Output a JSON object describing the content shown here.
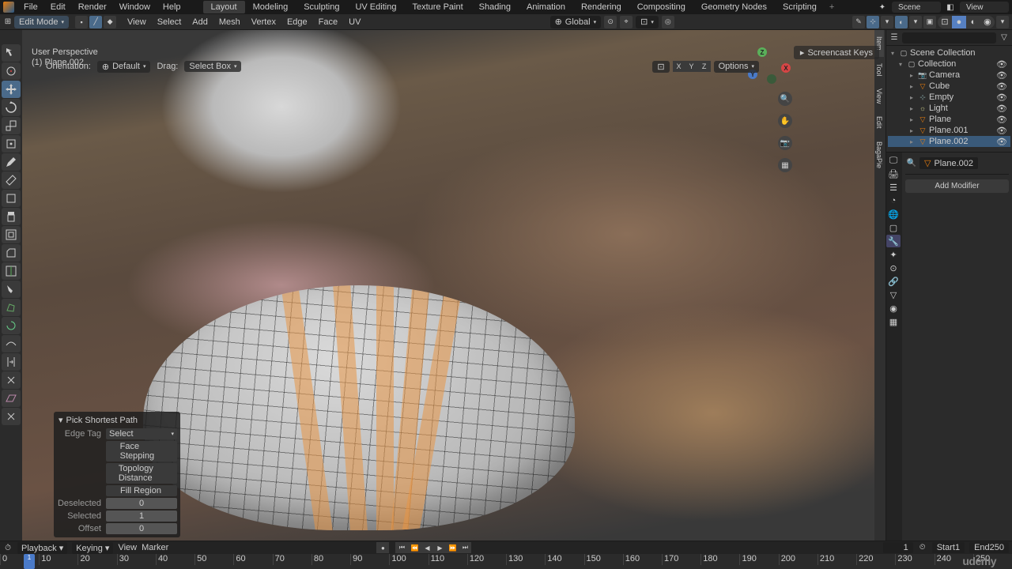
{
  "menu": {
    "file": "File",
    "edit": "Edit",
    "render": "Render",
    "window": "Window",
    "help": "Help"
  },
  "workspaces": {
    "layout": "Layout",
    "modeling": "Modeling",
    "sculpting": "Sculpting",
    "uv": "UV Editing",
    "texpaint": "Texture Paint",
    "shading": "Shading",
    "anim": "Animation",
    "render": "Rendering",
    "comp": "Compositing",
    "geo": "Geometry Nodes",
    "script": "Scripting"
  },
  "scene": {
    "scene_label": "Scene",
    "layer_label": "View"
  },
  "toolbar2": {
    "mode": "Edit Mode",
    "menus": {
      "view": "View",
      "select": "Select",
      "add": "Add",
      "mesh": "Mesh",
      "vertex": "Vertex",
      "edge": "Edge",
      "face": "Face",
      "uv": "UV"
    },
    "global": "Global"
  },
  "toolbar3": {
    "orient_label": "Orientation:",
    "orient_mode": "Default",
    "drag_label": "Drag:",
    "drag_mode": "Select Box",
    "options": "Options"
  },
  "overlay": {
    "persp": "User Perspective",
    "obj": "(1) Plane.002"
  },
  "rtabs": {
    "item": "Item",
    "tool": "Tool",
    "view": "View",
    "edit": "Edit",
    "bagapie": "BagaPie"
  },
  "scpanel": {
    "label": "Screencast Keys"
  },
  "gizmo": {
    "x": "X",
    "y": "Y",
    "z": "Z"
  },
  "outliner": {
    "search_placeholder": "",
    "collection": "Scene Collection",
    "coll2": "Collection",
    "items": [
      {
        "name": "Camera",
        "cls": "cam"
      },
      {
        "name": "Cube",
        "cls": "mesh"
      },
      {
        "name": "Empty",
        "cls": "empty"
      },
      {
        "name": "Light",
        "cls": "light"
      },
      {
        "name": "Plane",
        "cls": "mesh"
      },
      {
        "name": "Plane.001",
        "cls": "mesh"
      },
      {
        "name": "Plane.002",
        "cls": "mesh"
      }
    ]
  },
  "props": {
    "object": "Plane.002",
    "addmod": "Add Modifier"
  },
  "oppanel": {
    "title": "Pick Shortest Path",
    "edge_tag_label": "Edge Tag",
    "edge_tag_val": "Select",
    "face_step": "Face Stepping",
    "topo_dist": "Topology Distance",
    "fill_region": "Fill Region",
    "deselected_label": "Deselected",
    "deselected_val": "0",
    "selected_label": "Selected",
    "selected_val": "1",
    "offset_label": "Offset",
    "offset_val": "0"
  },
  "timeline": {
    "playback": "Playback",
    "keying": "Keying",
    "view": "View",
    "marker": "Marker",
    "current": "1",
    "start_label": "Start",
    "start": "1",
    "end_label": "End",
    "end": "250",
    "ticks": [
      "0",
      "10",
      "20",
      "30",
      "40",
      "50",
      "60",
      "70",
      "80",
      "90",
      "100",
      "110",
      "120",
      "130",
      "140",
      "150",
      "160",
      "170",
      "180",
      "190",
      "200",
      "210",
      "220",
      "230",
      "240",
      "250"
    ]
  },
  "watermark": "udemy"
}
